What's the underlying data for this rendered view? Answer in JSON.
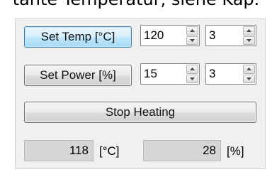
{
  "caption": "tante Temperatur, siehe Kap.",
  "temperature": {
    "button_label": "Set Temp [°C]",
    "setpoint": "120",
    "step": "3"
  },
  "power": {
    "button_label": "Set Power [%]",
    "setpoint": "15",
    "step": "3"
  },
  "stop_button_label": "Stop Heating",
  "readouts": {
    "temperature_value": "118",
    "temperature_unit": "[°C]",
    "power_value": "28",
    "power_unit": "[%]"
  }
}
